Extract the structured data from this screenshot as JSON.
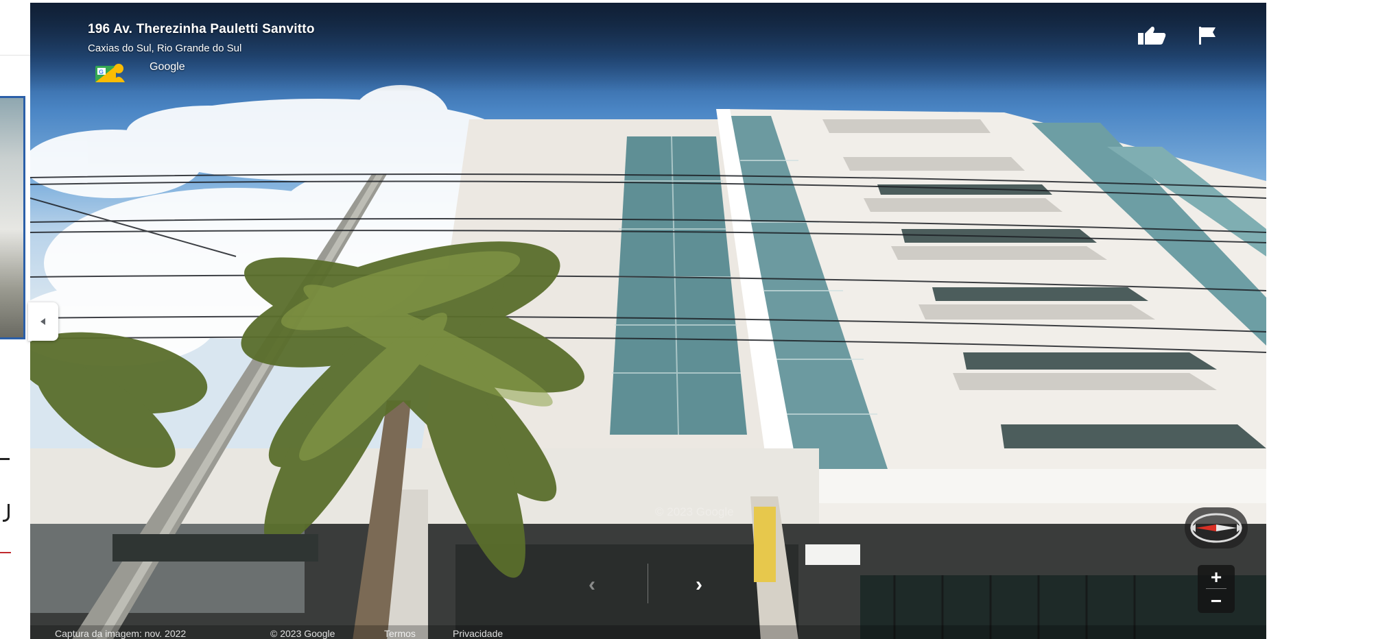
{
  "location": {
    "title": "196 Av. Therezinha Pauletti Sanvitto",
    "subtitle": "Caxias do Sul, Rio Grande do Sul",
    "provider": "Google"
  },
  "footer": {
    "capture_date": "Captura da imagem: nov. 2022",
    "copyright": "© 2023 Google",
    "terms": "Termos",
    "privacy": "Privacidade"
  },
  "watermark": "© 2023 Google",
  "controls": {
    "zoom_in": "+",
    "zoom_out": "−",
    "prev_arrow": "‹",
    "next_arrow": "›"
  },
  "icons": {
    "thumbs": "thumbs-up-icon",
    "flag": "flag-icon",
    "compass": "compass-icon",
    "contributor": "street-view-contributor-icon",
    "collapse": "collapse-arrow-icon"
  },
  "colors": {
    "compass_needle": "#d93025",
    "selected_border": "#2b5fa8",
    "sky_top": "#1c3352"
  }
}
